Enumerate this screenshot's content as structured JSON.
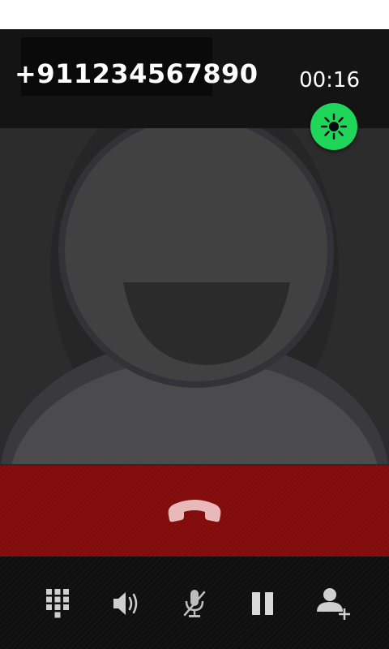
{
  "call": {
    "phone_number": "+911234567890",
    "timer": "00:16"
  },
  "icons": {
    "bluetooth": "bluetooth-icon",
    "end_call": "end-call-icon",
    "dialpad": "dialpad-icon",
    "speaker": "speaker-icon",
    "mute": "mute-microphone-icon",
    "hold": "pause-icon",
    "add_call": "add-call-icon",
    "avatar": "default-contact-avatar"
  },
  "colors": {
    "end_call_bar": "#830b0b",
    "bluetooth_active": "#1fd65a",
    "controls_bar": "#0f0f0f"
  }
}
